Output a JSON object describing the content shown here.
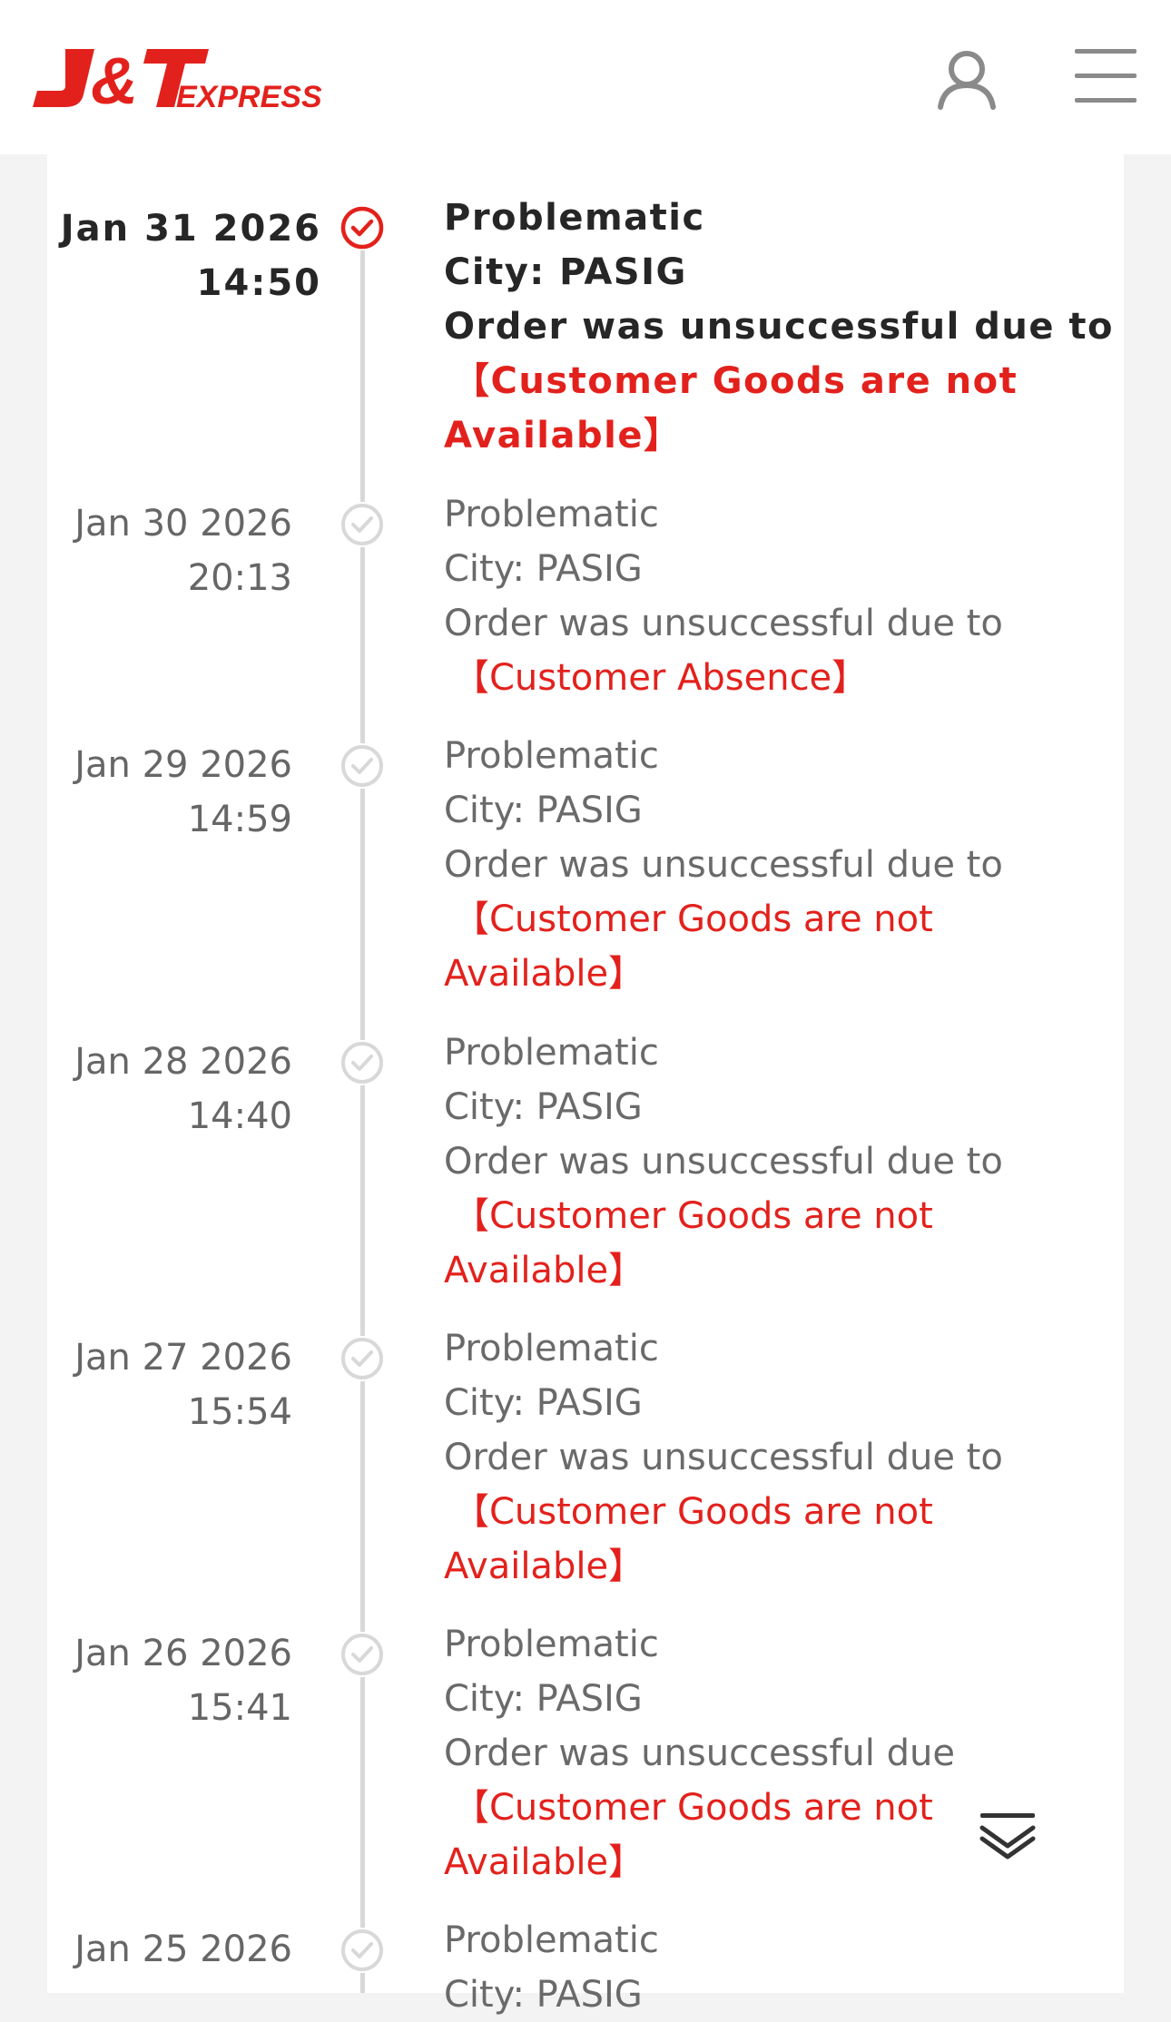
{
  "header": {
    "logo_text": "J&T EXPRESS",
    "user_icon": "user-icon",
    "menu_icon": "hamburger-menu-icon"
  },
  "colors": {
    "brand_red": "#e3211c",
    "latest_text": "#262626",
    "muted_text": "#6a6a6a",
    "timeline_gray": "#d8d8d8"
  },
  "timeline": {
    "events": [
      {
        "date": "Jan 31 2026",
        "time": "14:50",
        "status": "Problematic",
        "city": "City: PASIG",
        "message": "Order was unsuccessful due to",
        "reason": "【Customer Goods are not Available】",
        "latest": true,
        "icon": "check-circle-icon"
      },
      {
        "date": "Jan 30 2026",
        "time": "20:13",
        "status": "Problematic",
        "city": "City: PASIG",
        "message": "Order was unsuccessful due to",
        "reason": "【Customer Absence】",
        "icon": "check-circle-icon"
      },
      {
        "date": "Jan 29 2026",
        "time": "14:59",
        "status": "Problematic",
        "city": "City: PASIG",
        "message": "Order was unsuccessful due to",
        "reason": "【Customer Goods are not Available】",
        "icon": "check-circle-icon"
      },
      {
        "date": "Jan 28 2026",
        "time": "14:40",
        "status": "Problematic",
        "city": "City: PASIG",
        "message": "Order was unsuccessful due to",
        "reason": "【Customer Goods are not Available】",
        "icon": "check-circle-icon"
      },
      {
        "date": "Jan 27 2026",
        "time": "15:54",
        "status": "Problematic",
        "city": "City: PASIG",
        "message": "Order was unsuccessful due to",
        "reason": "【Customer Goods are not Available】",
        "icon": "check-circle-icon"
      },
      {
        "date": "Jan 26 2026",
        "time": "15:41",
        "status": "Problematic",
        "city": "City: PASIG",
        "message": "Order was unsuccessful due",
        "reason": "【Customer Goods are not Available】",
        "icon": "check-circle-icon"
      },
      {
        "date": "Jan 25 2026",
        "status": "Problematic",
        "city": "City: PASIG",
        "icon": "check-circle-icon"
      }
    ]
  },
  "expand_button": {
    "icon": "double-chevron-down-icon"
  }
}
